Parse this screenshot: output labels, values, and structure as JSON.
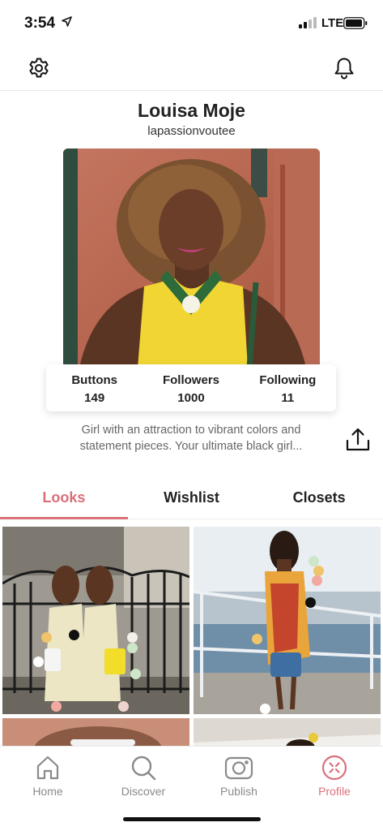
{
  "status_bar": {
    "time": "3:54",
    "network": "LTE"
  },
  "profile": {
    "name": "Louisa Moje",
    "handle": "lapassionvoutee",
    "bio": "Girl with an attraction to vibrant colors and statement pieces. Your ultimate black girl...",
    "stats": [
      {
        "label": "Buttons",
        "value": "149"
      },
      {
        "label": "Followers",
        "value": "1000"
      },
      {
        "label": "Following",
        "value": "11"
      }
    ]
  },
  "tabs": [
    {
      "label": "Looks",
      "active": true
    },
    {
      "label": "Wishlist",
      "active": false
    },
    {
      "label": "Closets",
      "active": false
    }
  ],
  "bottom_nav": [
    {
      "label": "Home",
      "icon": "home-icon",
      "active": false
    },
    {
      "label": "Discover",
      "icon": "search-icon",
      "active": false
    },
    {
      "label": "Publish",
      "icon": "camera-icon",
      "active": false
    },
    {
      "label": "Profile",
      "icon": "profile-icon",
      "active": true
    }
  ],
  "colors": {
    "accent": "#d9707a",
    "inactive": "#8a8a8a",
    "text": "#222222"
  },
  "icons": [
    "settings-icon",
    "bell-icon",
    "share-icon",
    "location-arrow-icon",
    "signal-icon",
    "battery-icon"
  ]
}
